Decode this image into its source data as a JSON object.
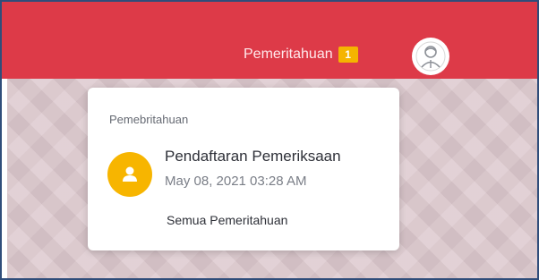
{
  "topbar": {
    "notifications_label": "Pemeritahuan",
    "notifications_count": "1",
    "accent_color": "#dd3a48",
    "badge_color": "#f5b400",
    "avatar_icon": "user-avatar-icon"
  },
  "dropdown": {
    "header": "Pemebritahuan",
    "items": [
      {
        "title": "Pendaftaran Pemeriksaan",
        "time": "May 08, 2021 03:28 AM",
        "icon": "user-icon",
        "icon_color": "#f7b500"
      }
    ],
    "see_all": "Semua Pemeritahuan"
  }
}
